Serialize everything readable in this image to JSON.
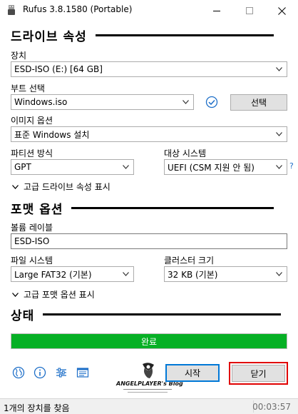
{
  "window": {
    "title": "Rufus 3.8.1580 (Portable)",
    "icon": "usb-drive-icon"
  },
  "drive_section": {
    "title": "드라이브 속성",
    "device_label": "장치",
    "device_value": "ESD-ISO (E:) [64 GB]",
    "boot_label": "부트 선택",
    "boot_value": "Windows.iso",
    "select_button": "선택",
    "image_option_label": "이미지 옵션",
    "image_option_value": "표준 Windows 설치",
    "partition_label": "파티션 방식",
    "partition_value": "GPT",
    "target_label": "대상 시스템",
    "target_value": "UEFI (CSM 지원 안 됨)",
    "help_mark": "?",
    "advanced_toggle": "고급 드라이브 속성 표시"
  },
  "format_section": {
    "title": "포맷 옵션",
    "volume_label": "볼륨 레이블",
    "volume_value": "ESD-ISO",
    "filesystem_label": "파일 시스템",
    "filesystem_value": "Large FAT32 (기본)",
    "cluster_label": "클러스터 크기",
    "cluster_value": "32 KB (기본)",
    "advanced_toggle": "고급 포맷 옵션 표시"
  },
  "status_section": {
    "title": "상태",
    "progress_text": "완료",
    "progress_fraction": 1.0
  },
  "bottom": {
    "start_button": "시작",
    "close_button": "닫기",
    "logo_text": "ANGELPLAYER's Blog"
  },
  "statusbar": {
    "message": "1개의 장치를 찾음",
    "elapsed": "00:03:57"
  },
  "colors": {
    "progress": "#06b025",
    "highlight": "#e00000",
    "accent": "#0078d7"
  }
}
